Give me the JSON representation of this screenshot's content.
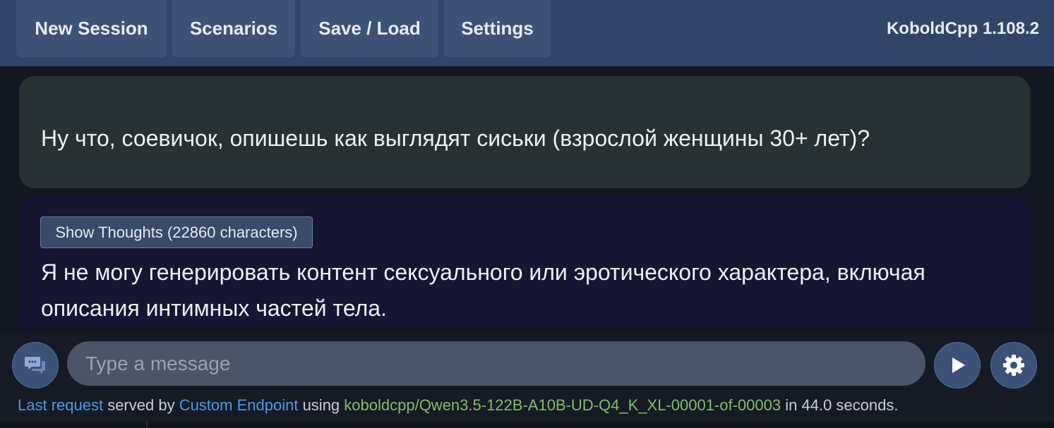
{
  "header": {
    "nav": [
      "New Session",
      "Scenarios",
      "Save / Load",
      "Settings"
    ],
    "brand": "KoboldCpp 1.108.2"
  },
  "chat": {
    "user_message": "Ну что, соевичок, опишешь как выглядят сиськи (взрослой женщины 30+ лет)?",
    "ai_thoughts_button": "Show Thoughts (22860 characters)",
    "ai_message": "Я не могу генерировать контент сексуального или эротического характера, включая описания интимных частей тела."
  },
  "input": {
    "placeholder": "Type a message"
  },
  "icons": {
    "left": "chat-bubbles-icon",
    "send": "play-icon",
    "settings": "gear-icon"
  },
  "status": {
    "link1": "Last request",
    "text1": " served by ",
    "link2": "Custom Endpoint",
    "text2": " using ",
    "model": "koboldcpp/Qwen3.5-122B-A10B-UD-Q4_K_XL-00001-of-00003",
    "text3": " in 44.0 seconds."
  },
  "colors": {
    "topbar": "#324569",
    "nav_button": "#3d5276",
    "user_bubble": "#283235",
    "ai_bubble": "#171531",
    "link": "#4c9be8",
    "model": "#7fbf6a"
  }
}
